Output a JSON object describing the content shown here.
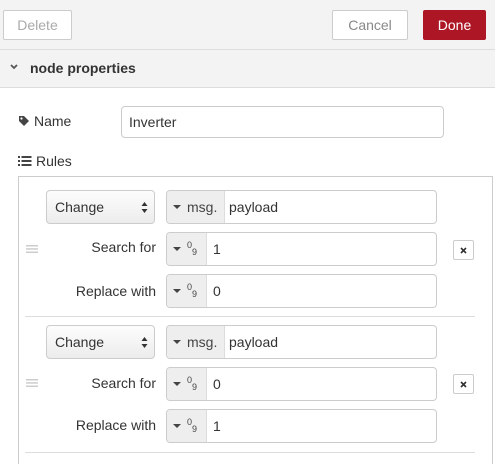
{
  "toolbar": {
    "delete_label": "Delete",
    "cancel_label": "Cancel",
    "done_label": "Done",
    "done_color": "#ad1625"
  },
  "section": {
    "title": "node properties"
  },
  "name_field": {
    "label": "Name",
    "value": "Inverter"
  },
  "rules": {
    "label": "Rules",
    "items": [
      {
        "action": "Change",
        "property_type": "msg.",
        "property": "payload",
        "search_label": "Search for",
        "search_value": "1",
        "replace_label": "Replace with",
        "replace_value": "0"
      },
      {
        "action": "Change",
        "property_type": "msg.",
        "property": "payload",
        "search_label": "Search for",
        "search_value": "0",
        "replace_label": "Replace with",
        "replace_value": "1"
      }
    ]
  }
}
